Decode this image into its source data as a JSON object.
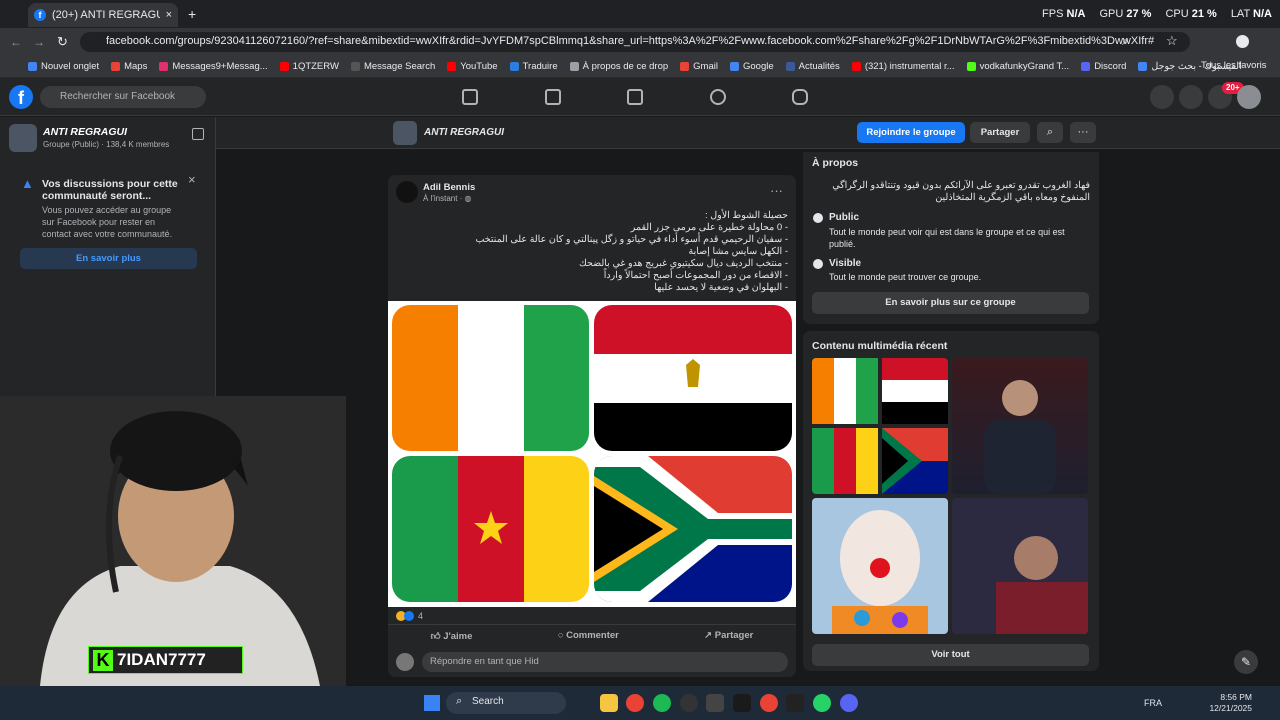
{
  "browser": {
    "tab_title": "(20+) ANTI REGRAGUI | Faceb",
    "new_tab": "+",
    "url": "facebook.com/groups/923041126072160/?ref=share&mibextid=wwXIfr&rdid=JvYFDM7spCBlmmq1&share_url=https%3A%2F%2Fwww.facebook.com%2Fshare%2Fg%2F1DrNbWTArG%2F%3Fmibextid%3DwwXIfr#",
    "bookmarks": [
      "Nouvel onglet",
      "Maps",
      "Messages9+Messag...",
      "1QTZERW",
      "Message Search",
      "YouTube",
      "Traduire",
      "À propos de ce drop",
      "Gmail",
      "Google",
      "Actualités",
      "(321) instrumental r...",
      "vodkafunkyGrand T...",
      "Discord",
      "الفيسبوك - بحث جوجل"
    ],
    "all_favorites": "Tous les favoris"
  },
  "perf": {
    "fps_label": "FPS",
    "fps": "N/A",
    "gpu_label": "GPU",
    "gpu": "27 %",
    "cpu_label": "CPU",
    "cpu": "21 %",
    "lat_label": "LAT",
    "lat": "N/A"
  },
  "fb": {
    "logo": "f",
    "search_placeholder": "Rechercher sur Facebook",
    "notif_badge": "20+"
  },
  "group": {
    "name": "ANTI REGRAGUI",
    "meta": "Groupe (Public) · 138,4 K membres",
    "join": "Rejoindre le groupe",
    "share": "Partager",
    "more": "···"
  },
  "notice": {
    "title": "Vos discussions pour cette communauté seront...",
    "body": "Vous pouvez accéder au groupe sur Facebook pour rester en contact avec votre communauté.",
    "button": "En savoir plus",
    "close": "×"
  },
  "post": {
    "author": "Adil Bennis",
    "time": "À l'instant · ",
    "lines": [
      "حصيلة الشوط الأول :",
      "- 0 محاولة خطيرة على مرمى جزر القمر",
      "- سفيان الرحيمي قدم أسوء أداء في حياتو و زگل پينالتي و كان عالة على المنتخب",
      "- الكهل سايس مشا إصابة",
      "- منتخب الرديف ديال سكيتيوي غبريج هدو غي بالضحك",
      "- الاقصاء من دور المجموعات أصبح احتمالاً وارداً",
      "- البهلوان في وضعية لا يحسد عليها"
    ],
    "reaction_count": "4",
    "like": "J'aime",
    "comment": "Commenter",
    "share": "Partager",
    "comment_placeholder": "Répondre en tant que Hid"
  },
  "about": {
    "title": "À propos",
    "desc": "فهاد الغروب تقدرو تعبرو على الآرائكم بدون قيود وتنتاقدو الرگراگي المنفوخ ومعاه باقي الزمگرية المتخاذلين",
    "public_title": "Public",
    "public_desc": "Tout le monde peut voir qui est dans le groupe et ce qui est publié.",
    "visible_title": "Visible",
    "visible_desc": "Tout le monde peut trouver ce groupe.",
    "more": "En savoir plus sur ce groupe"
  },
  "media": {
    "title": "Contenu multimédia récent",
    "see_all": "Voir tout"
  },
  "stream": {
    "handle": "7IDAN7777",
    "logo": "K"
  },
  "taskbar": {
    "search": "Search",
    "lang": "FRA",
    "time": "8:56 PM",
    "date": "12/21/2025"
  },
  "colors": {
    "fb_blue": "#1877f2",
    "bg": "#18191a",
    "card": "#242526",
    "kick_green": "#53fc18"
  }
}
